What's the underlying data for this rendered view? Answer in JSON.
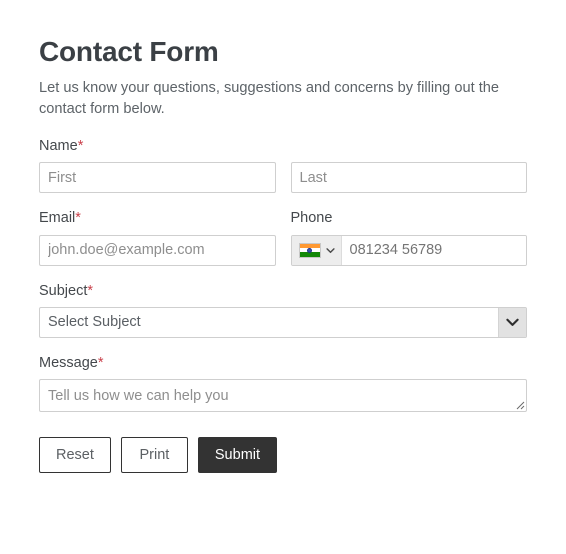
{
  "form": {
    "title": "Contact Form",
    "description": "Let us know your questions, suggestions and concerns by filling out the contact form below.",
    "required_marker": "*",
    "fields": {
      "name": {
        "label": "Name",
        "required": true,
        "first_placeholder": "First",
        "first_value": "",
        "last_placeholder": "Last",
        "last_value": ""
      },
      "email": {
        "label": "Email",
        "required": true,
        "placeholder": "john.doe@example.com",
        "value": ""
      },
      "phone": {
        "label": "Phone",
        "required": false,
        "country_flag": "india-flag-icon",
        "country_dropdown_icon": "chevron-down-icon",
        "placeholder": "081234 56789",
        "value": ""
      },
      "subject": {
        "label": "Subject",
        "required": true,
        "selected": "Select Subject",
        "dropdown_icon": "chevron-down-icon"
      },
      "message": {
        "label": "Message",
        "required": true,
        "placeholder": "Tell us how we can help you",
        "value": "",
        "resize_handle_icon": "resize-grip-icon"
      }
    },
    "buttons": {
      "reset": "Reset",
      "print": "Print",
      "submit": "Submit"
    },
    "colors": {
      "title": "#3b4045",
      "text": "#5d6368",
      "required_asterisk": "#c9404a",
      "border": "#cfcfcf",
      "submit_background": "#333333",
      "flag_saffron": "#ff9933",
      "flag_green": "#138808",
      "flag_chakra": "#3b4fa8"
    }
  }
}
